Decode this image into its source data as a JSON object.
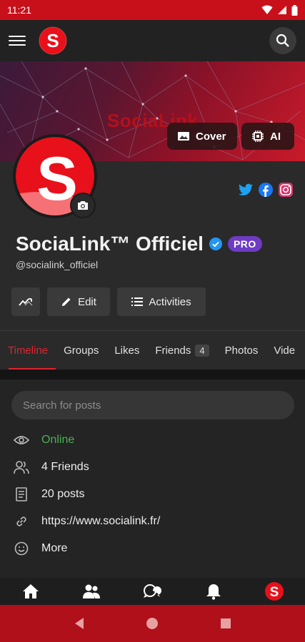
{
  "status_bar": {
    "time": "11:21"
  },
  "app_bar": {
    "menu_icon": "hamburger-menu-icon",
    "logo_icon": "socialink-logo-icon",
    "search_icon": "search-icon"
  },
  "cover": {
    "brand_text": "SociaLink",
    "cover_button_label": "Cover",
    "ai_button_label": "AI"
  },
  "profile": {
    "name": "SociaLink™ Officiel",
    "badge": "PRO",
    "handle": "@socialink_officiel",
    "socials": [
      "twitter-icon",
      "facebook-icon",
      "instagram-icon"
    ]
  },
  "actions": {
    "edit_label": "Edit",
    "activities_label": "Activities"
  },
  "tabs": [
    {
      "label": "Timeline",
      "active": true
    },
    {
      "label": "Groups"
    },
    {
      "label": "Likes"
    },
    {
      "label": "Friends",
      "count": "4"
    },
    {
      "label": "Photos"
    },
    {
      "label": "Vide"
    }
  ],
  "search": {
    "placeholder": "Search for posts"
  },
  "info": {
    "status": "Online",
    "friends": "4 Friends",
    "posts": "20 posts",
    "website": "https://www.socialink.fr/",
    "more": "More"
  },
  "colors": {
    "accent": "#c8101a",
    "pro": "#6e3bc4",
    "online": "#4caf50",
    "background": "#242424"
  }
}
